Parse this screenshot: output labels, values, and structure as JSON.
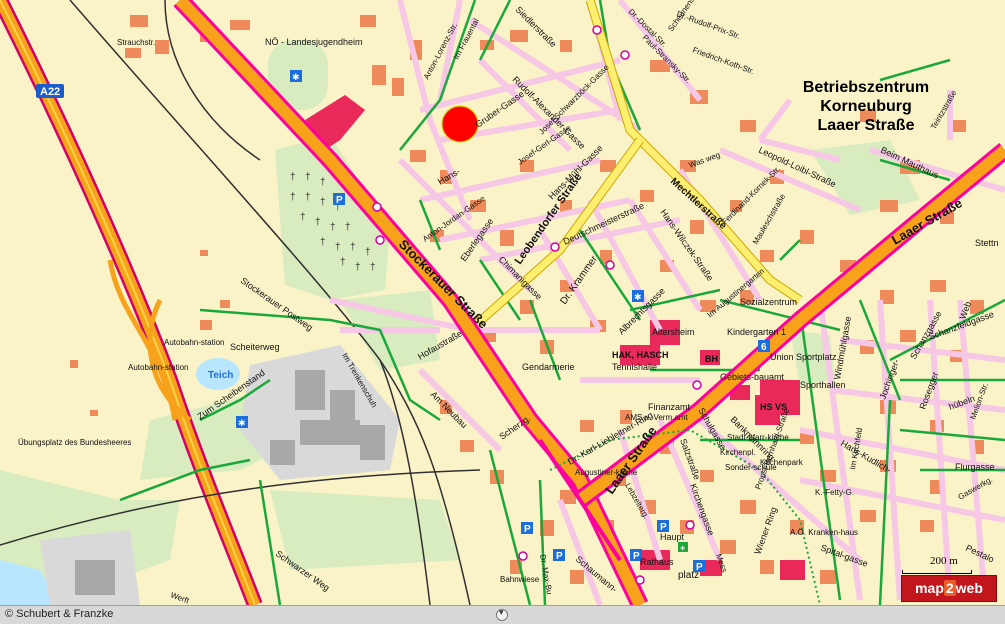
{
  "map": {
    "title_lines": [
      "Betriebszentrum",
      "Korneuburg",
      "Laaer Straße"
    ],
    "highway_label": "A22",
    "colors": {
      "land": "#faf3c8",
      "green": "#d8ecc0",
      "main_road": "#ff00a0",
      "main_road_fill": "#f7a21a",
      "secondary_road": "#ffef70",
      "street": "#f6c8e6",
      "building": "#ef8a5b",
      "path": "#1aa83a",
      "rail": "#303030",
      "water": "#b8e6ff",
      "marker": "#ff0000"
    },
    "labels": [
      {
        "id": "noe-landesjugendheim",
        "text": "NÖ - Landesjugendheim"
      },
      {
        "id": "strauchstr",
        "text": "Strauchstr."
      },
      {
        "id": "im-frauental",
        "text": "Im Frauental"
      },
      {
        "id": "anton-lorenz-str",
        "text": "Anton-Lorenz-Str."
      },
      {
        "id": "siedlerstrasse",
        "text": "Siedlerstraße"
      },
      {
        "id": "dr-dostal-str",
        "text": "Dr.-Dostal-Str."
      },
      {
        "id": "dr-rudolf-prix-str",
        "text": "Dr.-Rudolf-Prix-Str."
      },
      {
        "id": "paul-stransky-str",
        "text": "Paul-Stransky-Str."
      },
      {
        "id": "scheunenstrasse",
        "text": "Scheunenstraße"
      },
      {
        "id": "friedrich-koth-str",
        "text": "Friedrich-Koth-Str."
      },
      {
        "id": "rudolf-alexander-gasse",
        "text": "Rudolf-Alexander-Gasse"
      },
      {
        "id": "josef-schwarzboeck-gasse",
        "text": "Josef-Schwarzböck-Gasse"
      },
      {
        "id": "gruber-gasse",
        "text": "Gruber-Gasse"
      },
      {
        "id": "josef-gerl-gasse",
        "text": "Josef-Gerl-Gasse"
      },
      {
        "id": "hans-muehl-gasse",
        "text": "Hans-Mühl-Gasse"
      },
      {
        "id": "hans",
        "text": "Hans-"
      },
      {
        "id": "was-weg",
        "text": "Was weg"
      },
      {
        "id": "mechtlerstrasse",
        "text": "Mechtlerstraße"
      },
      {
        "id": "leopold-loibl-strasse",
        "text": "Leopold-Loibl-Straße"
      },
      {
        "id": "teiritzstrasse",
        "text": "Teiritzstraße"
      },
      {
        "id": "beim-mauthaus",
        "text": "Beim Mauthaus"
      },
      {
        "id": "laaer-strasse-east",
        "text": "Laaer Straße"
      },
      {
        "id": "stettner",
        "text": "Stettn"
      },
      {
        "id": "anton-jordan-gasse",
        "text": "Anton-Jordan-Gasse"
      },
      {
        "id": "eberlegasse",
        "text": "Eberlegasse"
      },
      {
        "id": "leobendorfer-strasse",
        "text": "Leobendorfer Straße"
      },
      {
        "id": "deutschmeisterstrasse",
        "text": "Deutschmeisterstraße"
      },
      {
        "id": "hans-wilczek-strasse",
        "text": "Hans-Wilczek-Straße"
      },
      {
        "id": "ferdinand-kornek-str",
        "text": "Ferdinand-Kornek-Str."
      },
      {
        "id": "mauleschstrasse",
        "text": "Mauleschstraße"
      },
      {
        "id": "chimanigasse",
        "text": "Chimanigasse"
      },
      {
        "id": "dr-krammer",
        "text": "Dr. Krammer"
      },
      {
        "id": "albrechtsgasse",
        "text": "Albrechtsgasse"
      },
      {
        "id": "im-augustinergarten",
        "text": "Im Augustinergarten"
      },
      {
        "id": "sozialzentrum",
        "text": "Sozialzentrum"
      },
      {
        "id": "stockerauer-strasse",
        "text": "Stockerauer Straße"
      },
      {
        "id": "altersheim",
        "text": "Altersheim"
      },
      {
        "id": "kindergarten-1",
        "text": "Kindergarten 1"
      },
      {
        "id": "hofaustrasse",
        "text": "Hofaustraße"
      },
      {
        "id": "gendarmerie",
        "text": "Gendarmerie"
      },
      {
        "id": "hak-hasch",
        "text": "HAK, HASCH"
      },
      {
        "id": "tennishalle",
        "text": "Tennishalle"
      },
      {
        "id": "bh",
        "text": "BH"
      },
      {
        "id": "union-sportplatz",
        "text": "Union Sportplatz"
      },
      {
        "id": "windmuehlgasse",
        "text": "Windmühlgasse"
      },
      {
        "id": "schanzgasse",
        "text": "Schanzgasse"
      },
      {
        "id": "web",
        "text": "Web"
      },
      {
        "id": "schanzfeldgasse",
        "text": "Schanzfeldgasse"
      },
      {
        "id": "stockerauer-postweg",
        "text": "Stockerauer Postweg"
      },
      {
        "id": "autobahnstation-1",
        "text": "Autobahn-station"
      },
      {
        "id": "autobahnstation-2",
        "text": "Autobahn-station"
      },
      {
        "id": "scheiterweg",
        "text": "Scheiterweg"
      },
      {
        "id": "teich",
        "text": "Teich"
      },
      {
        "id": "zum-scheibenstand",
        "text": "Zum Scheibenstand"
      },
      {
        "id": "im-trenkenschuh",
        "text": "Im Trenkenschuh"
      },
      {
        "id": "am-neubau",
        "text": "Am Neubau"
      },
      {
        "id": "dr-karl-liebleitner-ring",
        "text": "Dr.-Karl-Liebleitner-Ring"
      },
      {
        "id": "gebietsbauamt",
        "text": "Gebiets-bauamt"
      },
      {
        "id": "hs-vs",
        "text": "HS  VS"
      },
      {
        "id": "sporthallen",
        "text": "Sporthallen"
      },
      {
        "id": "jochinger",
        "text": "Jochinger-"
      },
      {
        "id": "rosegger",
        "text": "Rosegger"
      },
      {
        "id": "huebeln",
        "text": "hübeln"
      },
      {
        "id": "finanzamt",
        "text": "Finanzamt"
      },
      {
        "id": "ams-vermamt",
        "text": "AMS u. Verm.amt"
      },
      {
        "id": "schulgasse",
        "text": "Schulgasse"
      },
      {
        "id": "bankmannring",
        "text": "Bankmannring"
      },
      {
        "id": "hans-kudlich",
        "text": "Hans-Kudlich-"
      },
      {
        "id": "flurgasse",
        "text": "Flurgasse"
      },
      {
        "id": "melion-str",
        "text": "Melion-Str."
      },
      {
        "id": "uebungsplatz",
        "text": "Übungsplatz des Bundesheeres"
      },
      {
        "id": "scherzg",
        "text": "Scherzg."
      },
      {
        "id": "laaer-strasse-south",
        "text": "Laaer Straße"
      },
      {
        "id": "stadtpfarrkirche",
        "text": "Stadt-pfarr-kirche"
      },
      {
        "id": "kirchenpl",
        "text": "Kirchenpl."
      },
      {
        "id": "sonderschule",
        "text": "Sonder-schule"
      },
      {
        "id": "kirchenpark",
        "text": "Kirchenpark"
      },
      {
        "id": "im-kirchfeld",
        "text": "Im Kirchfeld"
      },
      {
        "id": "k-fetty-g",
        "text": "K.-Fetty-G."
      },
      {
        "id": "gaswerkg",
        "text": "Gaswerkg."
      },
      {
        "id": "augustinerkirche",
        "text": "Augustiner-kirche"
      },
      {
        "id": "salzstrasse",
        "text": "Salzstraße"
      },
      {
        "id": "lebzelterg",
        "text": "Lebzelterg."
      },
      {
        "id": "kirchengasse",
        "text": "Kirchengasse"
      },
      {
        "id": "propst-bernhard-strasse",
        "text": "Propst-Bernhard-Straße"
      },
      {
        "id": "wiener-ring",
        "text": "Wiener Ring"
      },
      {
        "id": "ao-krankenhaus",
        "text": "A.Ö. Kranken-haus"
      },
      {
        "id": "spitalgasse",
        "text": "Spital-gasse"
      },
      {
        "id": "pestalozzi",
        "text": "Pestalo"
      },
      {
        "id": "schwarzer-weg",
        "text": "Schwarzer Weg"
      },
      {
        "id": "dr-max-burckhard",
        "text": "Dr.-Max-Bu"
      },
      {
        "id": "bahnwiese",
        "text": "Bahnwiese"
      },
      {
        "id": "schaumann",
        "text": "Schaumann-"
      },
      {
        "id": "hauptplatz-1",
        "text": "Haupt"
      },
      {
        "id": "hauptplatz-2",
        "text": "platz"
      },
      {
        "id": "rathaus",
        "text": "Rathaus"
      },
      {
        "id": "werft",
        "text": "Werft"
      },
      {
        "id": "mess",
        "text": "Mess"
      }
    ]
  },
  "scale_label": "200 m",
  "logo_text": "map2web",
  "logo_parts": [
    "map",
    "2",
    "web"
  ],
  "footer": {
    "copyright": "© Schubert & Franzke"
  }
}
